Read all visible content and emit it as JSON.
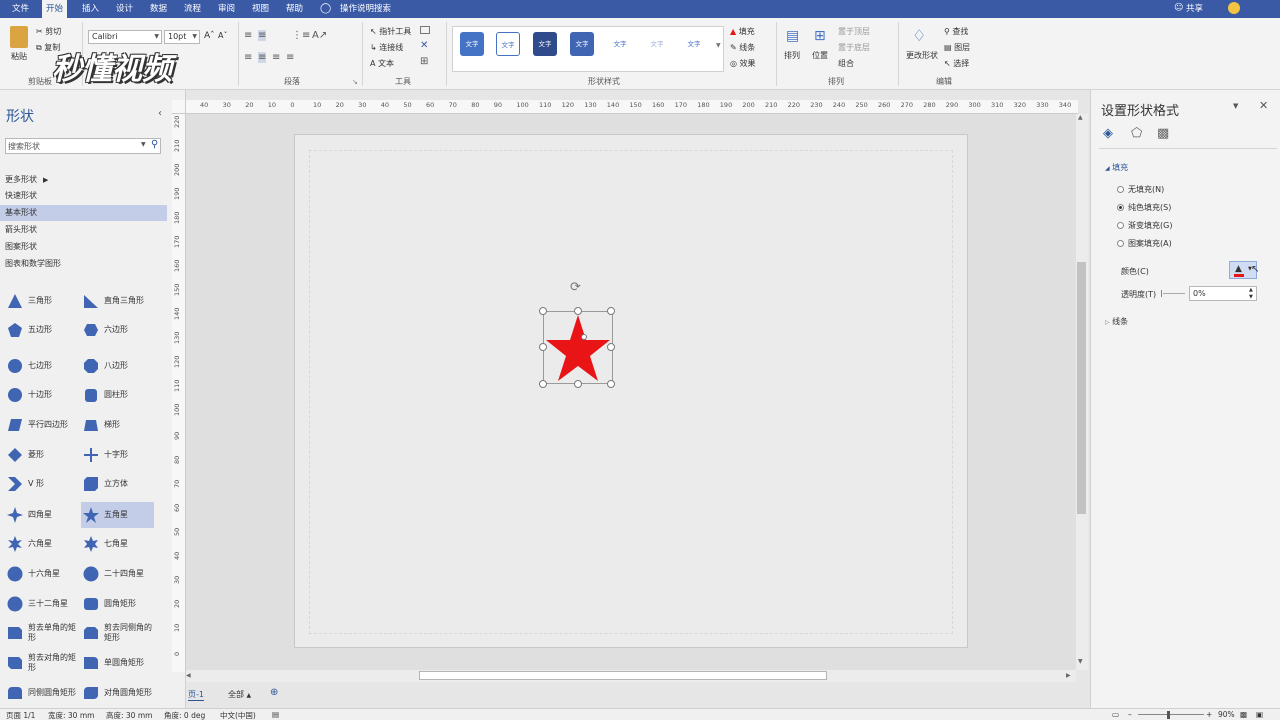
{
  "menu": [
    "文件",
    "开始",
    "插入",
    "设计",
    "数据",
    "流程",
    "审阅",
    "视图",
    "帮助",
    "操作说明搜索"
  ],
  "menu_active": "开始",
  "share_label": "共享",
  "ribbon": {
    "clipboard": {
      "paste": "粘贴",
      "cut": "剪切",
      "copy": "复制",
      "format": "格式刷",
      "label": "剪贴板"
    },
    "font": {
      "name": "Calibri",
      "size": "10pt"
    },
    "paragraph_label": "段落",
    "tools": {
      "pointer": "指针工具",
      "connector": "连接线",
      "text": "文本",
      "label": "工具"
    },
    "shape_style_label": "形状样式",
    "style_text": "文字",
    "fill": "填充",
    "line": "线条",
    "effect": "效果",
    "arrange": {
      "arrange": "排列",
      "position": "位置",
      "bring_front": "置于顶层",
      "send_back": "置于底层",
      "group": "组合",
      "label": "排列"
    },
    "editing": {
      "change_shape": "更改形状",
      "find": "查找",
      "layers": "图层",
      "select": "选择",
      "label": "编辑"
    }
  },
  "watermark": "秒懂视频",
  "shapes_panel": {
    "title": "形状",
    "search_placeholder": "搜索形状",
    "categories": [
      "更多形状",
      "快速形状",
      "基本形状",
      "箭头形状",
      "图案形状",
      "图表和数学图形"
    ],
    "selected_category": "基本形状",
    "shapes": [
      [
        "三角形",
        "直角三角形"
      ],
      [
        "五边形",
        "六边形"
      ],
      [
        "七边形",
        "八边形"
      ],
      [
        "十边形",
        "圆柱形"
      ],
      [
        "平行四边形",
        "梯形"
      ],
      [
        "菱形",
        "十字形"
      ],
      [
        "V 形",
        "立方体"
      ],
      [
        "四角星",
        "五角星"
      ],
      [
        "六角星",
        "七角星"
      ],
      [
        "十六角星",
        "二十四角星"
      ],
      [
        "三十二角星",
        "圆角矩形"
      ],
      [
        "剪去单角的矩形",
        "剪去同侧角的矩形"
      ],
      [
        "剪去对角的矩形",
        "单圆角矩形"
      ],
      [
        "同侧圆角矩形",
        "对角圆角矩形"
      ]
    ],
    "selected_shape": "五角星"
  },
  "ruler_top": [
    "40",
    "30",
    "20",
    "10",
    "0",
    "10",
    "20",
    "30",
    "40",
    "50",
    "60",
    "70",
    "80",
    "90",
    "100",
    "110",
    "120",
    "130",
    "140",
    "150",
    "160",
    "170",
    "180",
    "190",
    "200",
    "210",
    "220",
    "230",
    "240",
    "250",
    "260",
    "270",
    "280",
    "290",
    "300",
    "310",
    "320",
    "330",
    "340"
  ],
  "ruler_left": [
    "220",
    "210",
    "200",
    "190",
    "180",
    "170",
    "160",
    "150",
    "140",
    "130",
    "120",
    "110",
    "100",
    "90",
    "80",
    "70",
    "60",
    "50",
    "40",
    "30",
    "20",
    "10",
    "0"
  ],
  "page_tabs": {
    "current": "页-1",
    "all": "全部"
  },
  "format_panel": {
    "title": "设置形状格式",
    "fill_section": "填充",
    "options": [
      "无填充(N)",
      "纯色填充(S)",
      "渐变填充(G)",
      "图案填充(A)"
    ],
    "selected_option": "纯色填充(S)",
    "color_label": "颜色(C)",
    "transparency_label": "透明度(T)",
    "transparency_value": "0%",
    "line_section": "线条"
  },
  "star_color": "#e81416",
  "status": {
    "page": "页面 1/1",
    "width": "宽度: 30 mm",
    "height": "高度: 30 mm",
    "angle": "角度: 0 deg",
    "lang": "中文(中国)",
    "zoom": "90%"
  }
}
